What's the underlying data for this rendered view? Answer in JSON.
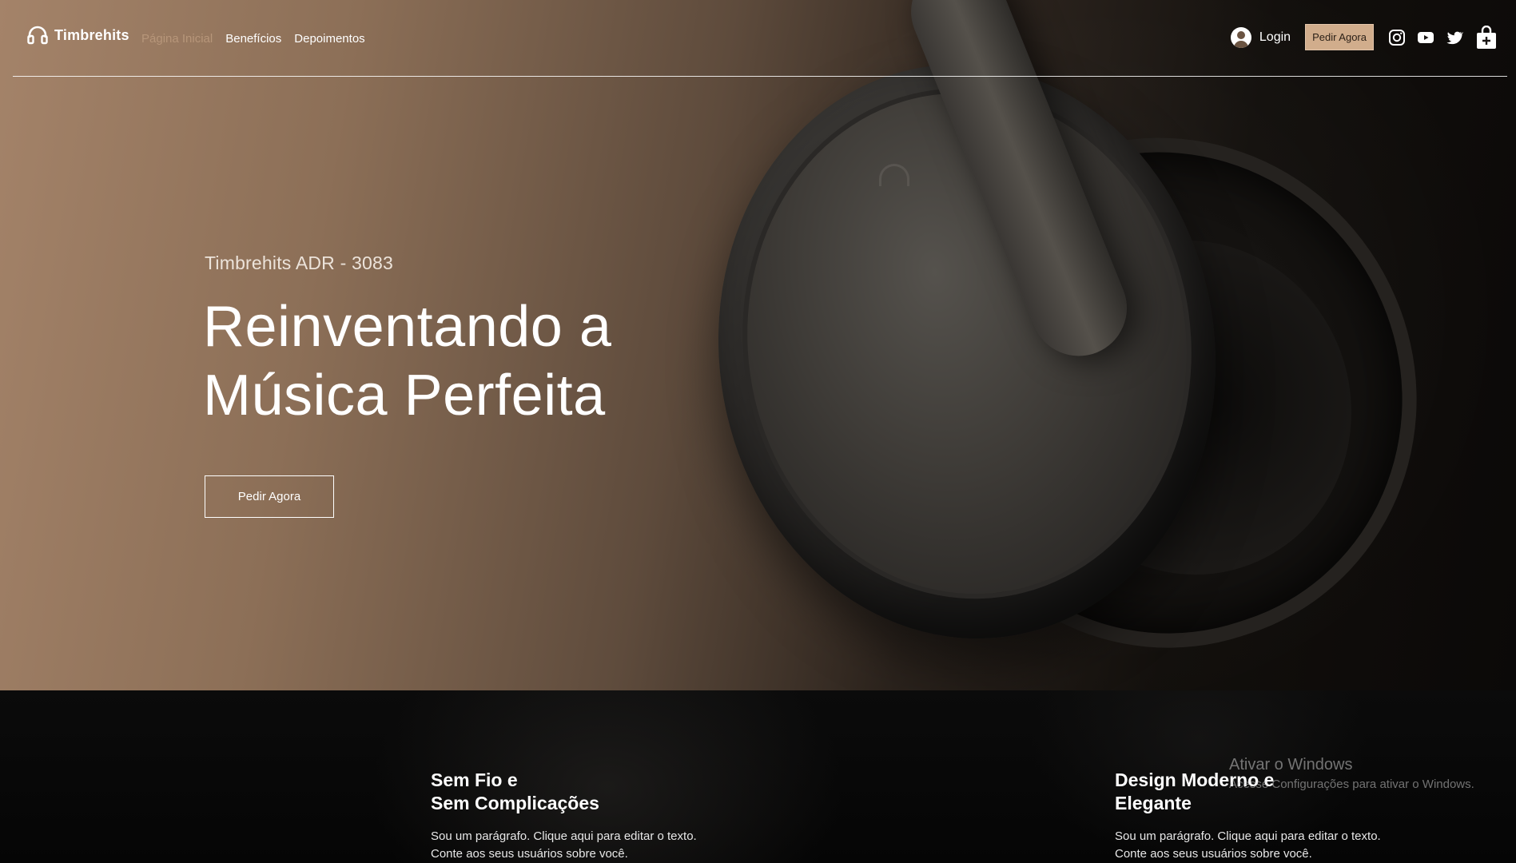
{
  "brand": {
    "name": "Timbrehits",
    "icon": "headphones-icon"
  },
  "nav": {
    "items": [
      {
        "label": "Página Inicial",
        "active": true
      },
      {
        "label": "Benefícios",
        "active": false
      },
      {
        "label": "Depoimentos",
        "active": false
      }
    ],
    "login_label": "Login",
    "order_label": "Pedir Agora",
    "social": [
      "instagram-icon",
      "youtube-icon",
      "twitter-icon"
    ],
    "cart_icon": "shopping-bag-icon"
  },
  "hero": {
    "subtitle": "Timbrehits ADR - 3083",
    "headline_line1": "Reinventando a",
    "headline_line2": "Música Perfeita",
    "cta_label": "Pedir Agora"
  },
  "features": [
    {
      "title_line1": "Sem Fio e",
      "title_line2": "Sem Complicações",
      "text_line1": "Sou um parágrafo. Clique aqui para editar o texto.",
      "text_line2": "Conte aos seus usuários sobre você."
    },
    {
      "title_line1": "Design Moderno e",
      "title_line2": "Elegante",
      "text_line1": "Sou um parágrafo. Clique aqui para editar o texto.",
      "text_line2": "Conte aos seus usuários sobre você."
    }
  ],
  "watermark": {
    "title": "Ativar o Windows",
    "text": "Acesse Configurações para ativar o Windows."
  },
  "colors": {
    "accent": "#d1ad8c",
    "active_nav": "#b7967a",
    "hero_left": "#a48369",
    "dark": "#0b0908"
  }
}
